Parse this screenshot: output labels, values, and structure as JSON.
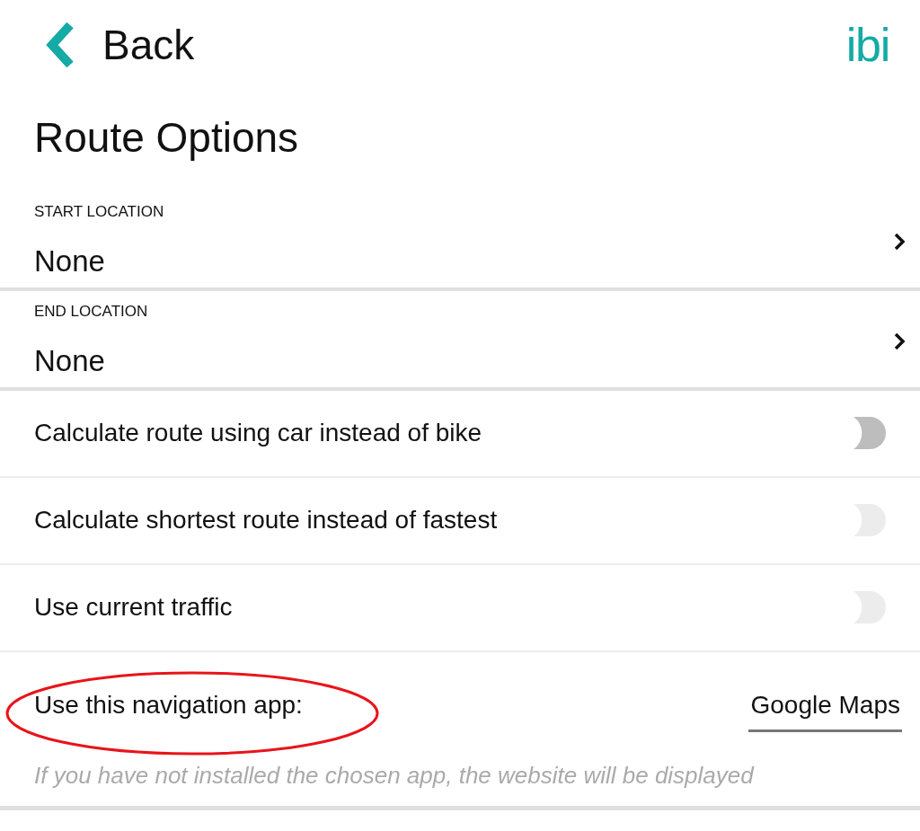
{
  "header": {
    "back_label": "Back",
    "logo": "ibi"
  },
  "title": "Route Options",
  "locations": [
    {
      "label": "START LOCATION",
      "value": "None"
    },
    {
      "label": "END LOCATION",
      "value": "None"
    }
  ],
  "toggles": [
    {
      "label": "Calculate route using car instead of bike",
      "on": false,
      "disabled": false
    },
    {
      "label": "Calculate shortest route instead of fastest",
      "on": false,
      "disabled": true
    },
    {
      "label": "Use current traffic",
      "on": false,
      "disabled": true
    }
  ],
  "navigation_app": {
    "label": "Use this navigation app:",
    "value": "Google Maps",
    "highlighted": true
  },
  "hint": "If you have not installed the chosen app, the website will be displayed"
}
